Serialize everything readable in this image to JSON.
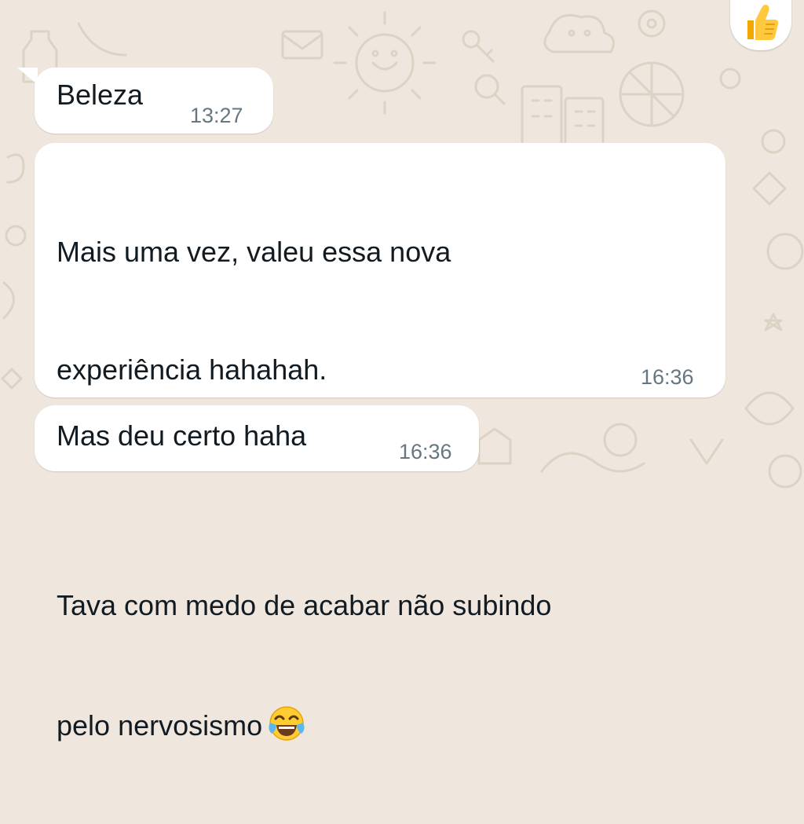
{
  "chat": {
    "reaction": {
      "emoji": "👍",
      "icon": "thumbs-up-icon"
    },
    "messages": [
      {
        "text": "Beleza",
        "time": "13:27"
      },
      {
        "line1": "Mais uma vez, valeu essa nova",
        "line2": "experiência hahahah.",
        "line3": "Tava com medo de acabar não subindo",
        "line4": "pelo nervosismo",
        "emoji": "😂",
        "emoji_icon": "tears-of-joy-icon",
        "time": "16:36"
      },
      {
        "text": "Mas deu certo haha",
        "time": "16:36"
      }
    ]
  },
  "colors": {
    "wallpaper": "#efe7de",
    "doodle": "#ddd3c5",
    "bubble": "#ffffff",
    "text": "#111b21",
    "timestamp": "#667781"
  }
}
